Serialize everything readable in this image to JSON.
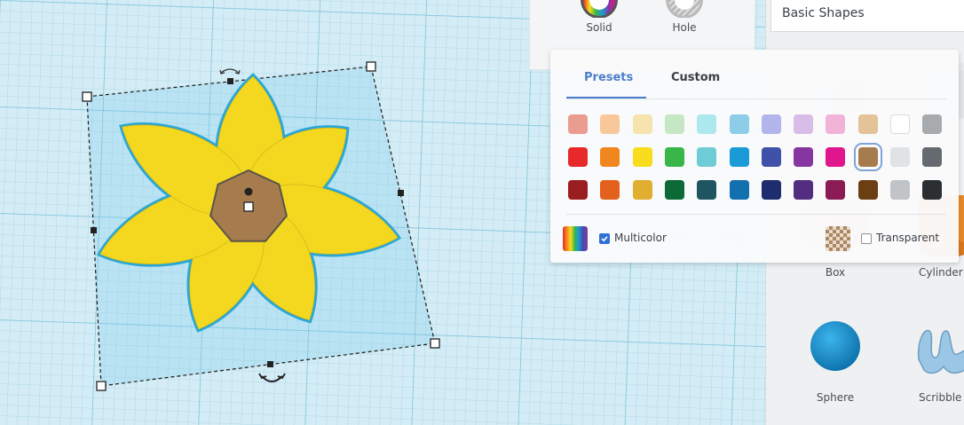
{
  "properties": {
    "solid_label": "Solid",
    "hole_label": "Hole"
  },
  "shapes_panel": {
    "category": "Basic Shapes",
    "items": [
      {
        "label": "Box",
        "icon": "box-icon"
      },
      {
        "label": "Cylinder",
        "icon": "cylinder-icon"
      },
      {
        "label": "Sphere",
        "icon": "sphere-icon"
      },
      {
        "label": "Scribble",
        "icon": "scribble-icon"
      }
    ]
  },
  "color_picker": {
    "tabs": [
      "Presets",
      "Custom"
    ],
    "active_tab": "Presets",
    "selected_color": "#a67c4e",
    "swatches": [
      [
        "#ea9c90",
        "#f9c89a",
        "#f7e3ad",
        "#c6e7c3",
        "#ace8ed",
        "#8dcde8",
        "#b1b5ec",
        "#d7bde7",
        "#f2b3d8",
        "#e3c397",
        "#ffffff",
        "#a7abae"
      ],
      [
        "#e8292b",
        "#f0861e",
        "#f9dc1d",
        "#39b54a",
        "#6dccd6",
        "#1b9ad8",
        "#3f51a9",
        "#8736a1",
        "#e0168d",
        "#a67c4e",
        "#dfe3e5",
        "#646a6f"
      ],
      [
        "#9a1d20",
        "#e3601d",
        "#e0ae31",
        "#0b6a35",
        "#1f5560",
        "#1270af",
        "#1e2d6d",
        "#522d80",
        "#8a1b54",
        "#6b3f13",
        "#c0c4c7",
        "#2c2f32"
      ]
    ],
    "multicolor_label": "Multicolor",
    "multicolor_checked": true,
    "transparent_label": "Transparent",
    "transparent_checked": false
  },
  "colors": {
    "accent": "#4a7fc9",
    "flower_petal": "#f4d71f",
    "flower_center": "#a67c4e",
    "selection_outline": "#29a8d6"
  }
}
